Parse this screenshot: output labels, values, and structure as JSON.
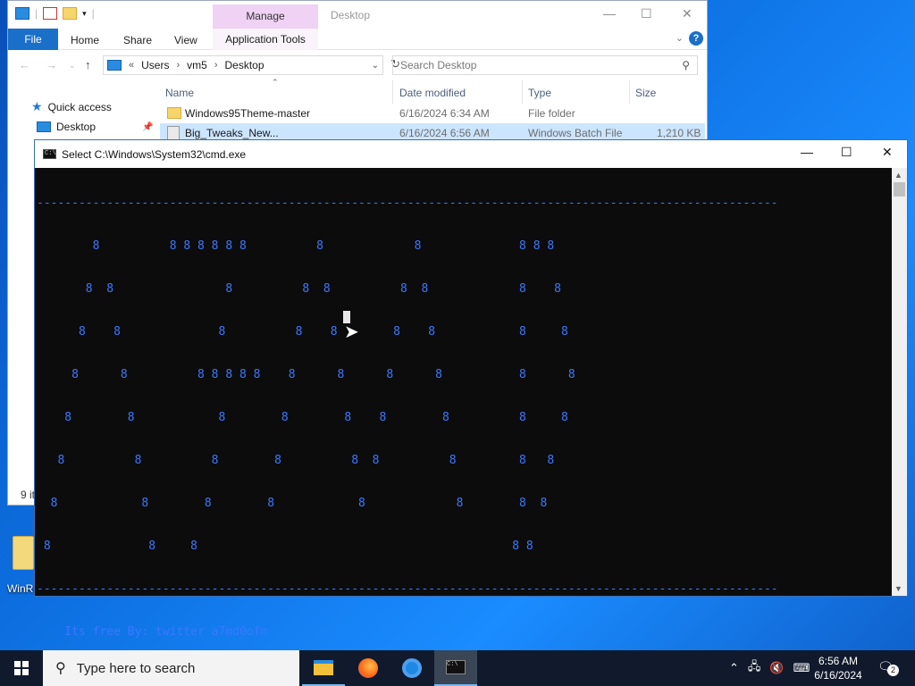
{
  "desktop": {
    "icon_label": "WinRe"
  },
  "explorer": {
    "title": "Desktop",
    "contextual_tab": "Manage",
    "tabs": [
      "File",
      "Home",
      "Share",
      "View",
      "Application Tools"
    ],
    "address": [
      "Users",
      "vm5",
      "Desktop"
    ],
    "address_prefix": "«",
    "search_placeholder": "Search Desktop",
    "nav": [
      {
        "label": "Quick access"
      },
      {
        "label": "Desktop"
      }
    ],
    "columns": [
      "Name",
      "Date modified",
      "Type",
      "Size"
    ],
    "files": [
      {
        "name": "Windows95Theme-master",
        "date": "6/16/2024 6:34 AM",
        "type": "File folder",
        "size": ""
      },
      {
        "name": "Big_Tweaks_New...",
        "date": "6/16/2024 6:56 AM",
        "type": "Windows Batch File",
        "size": "1,210 KB"
      }
    ],
    "status": "9 it"
  },
  "cmd": {
    "title": "Select C:\\Windows\\System32\\cmd.exe",
    "banner_lines": [
      "----------------------------------------------------------------------------------------------------------",
      "        8          8 8 8 8 8 8          8             8              8 8 8",
      "       8  8                8          8  8          8  8             8    8",
      "      8    8              8          8    8        8    8            8     8",
      "     8      8          8 8 8 8 8    8      8      8      8           8      8",
      "    8        8            8        8        8    8        8          8     8",
      "   8          8          8        8          8  8          8         8   8",
      "  8            8        8        8            8             8        8  8",
      " 8              8     8                                             8 8",
      "----------------------------------------------------------------------------------------------------------",
      "    Its free By: twitter a7md0ofn"
    ]
  },
  "taskbar": {
    "search_placeholder": "Type here to search",
    "apps": [
      {
        "name": "file-explorer"
      },
      {
        "name": "firefox"
      },
      {
        "name": "chrome"
      },
      {
        "name": "cmd"
      }
    ],
    "clock_time": "6:56 AM",
    "clock_date": "6/16/2024",
    "notifications": "2"
  }
}
